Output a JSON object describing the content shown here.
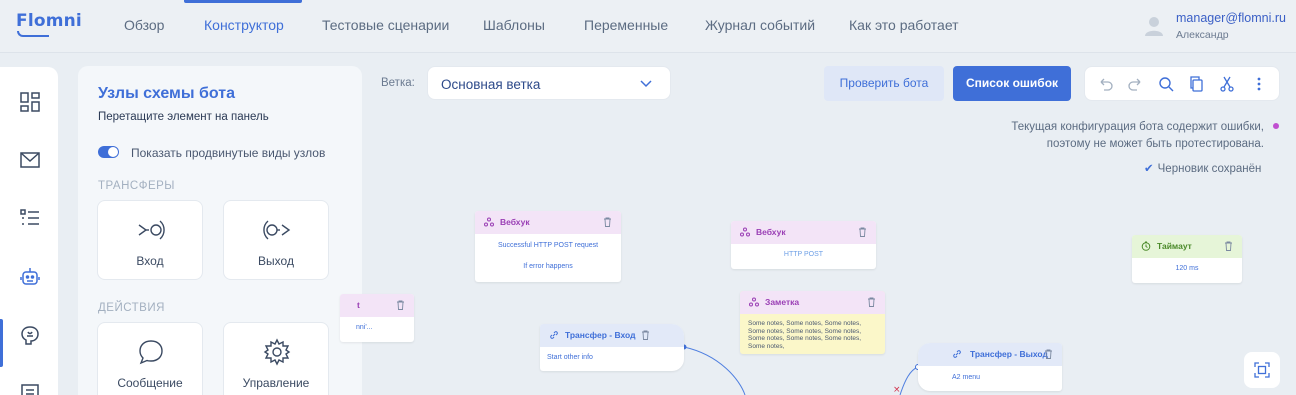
{
  "app": {
    "logo": "Flomni"
  },
  "nav": {
    "items": [
      {
        "label": "Обзор"
      },
      {
        "label": "Конструктор"
      },
      {
        "label": "Тестовые сценарии"
      },
      {
        "label": "Шаблоны"
      },
      {
        "label": "Переменные"
      },
      {
        "label": "Журнал событий"
      },
      {
        "label": "Как это работает"
      }
    ],
    "active": "Конструктор"
  },
  "user": {
    "email": "manager@flomni.ru",
    "name": "Александр"
  },
  "rail": {
    "icons": [
      "dashboard-icon",
      "mail-icon",
      "list-icon",
      "bot-icon",
      "brain-icon",
      "document-icon"
    ],
    "active": "bot-icon"
  },
  "panel": {
    "title": "Узлы схемы бота",
    "subtitle": "Перетащите элемент на панель",
    "toggle_label": "Показать продвинутые виды узлов",
    "sections": [
      {
        "label": "ТРАНСФЕРЫ",
        "tiles": [
          {
            "label": "Вход",
            "icon": "transfer-in-icon"
          },
          {
            "label": "Выход",
            "icon": "transfer-out-icon"
          }
        ]
      },
      {
        "label": "ДЕЙСТВИЯ",
        "tiles": [
          {
            "label": "Сообщение",
            "icon": "message-icon"
          },
          {
            "label": "Управление",
            "icon": "gear-icon"
          }
        ]
      }
    ]
  },
  "toolbar": {
    "branch_label": "Ветка:",
    "branch_value": "Основная ветка",
    "check_button": "Проверить бота",
    "errors_button": "Список ошибок",
    "tools": [
      "undo-icon",
      "redo-icon",
      "search-icon",
      "copy-icon",
      "cut-icon",
      "more-icon"
    ]
  },
  "status": {
    "error_line1": "Текущая конфигурация бота содержит ошибки,",
    "error_line2": "поэтому не может быть протестирована.",
    "draft": "Черновик сохранён",
    "error_color": "#c04fd0"
  },
  "nodes": [
    {
      "id": "webhook1",
      "title": "Вебхук",
      "lines": [
        "Successful HTTP POST request",
        "If error happens"
      ]
    },
    {
      "id": "webhook2",
      "title": "Вебхук",
      "lines": [
        "HTTP POST"
      ]
    },
    {
      "id": "timeout",
      "title": "Таймаут",
      "lines": [
        "120 ms"
      ]
    },
    {
      "id": "partial",
      "title": "t",
      "lines": [
        "nni'..."
      ]
    },
    {
      "id": "transfer-in",
      "title": "Трансфер - Вход",
      "lines": [
        "Start other info"
      ]
    },
    {
      "id": "note",
      "title": "Заметка",
      "lines": [
        "Some notes, Some notes, Some notes, Some notes, Some notes, Some notes, Some notes, Some notes, Some notes, Some notes,"
      ]
    },
    {
      "id": "transfer-out",
      "title": "Трансфер - Выход",
      "lines": [
        "A2 menu"
      ]
    }
  ],
  "colors": {
    "accent": "#3f6fd8",
    "webhook": "#9a3fb5",
    "note_bg": "#fbf7c9",
    "timeout": "#4b8a2a"
  }
}
